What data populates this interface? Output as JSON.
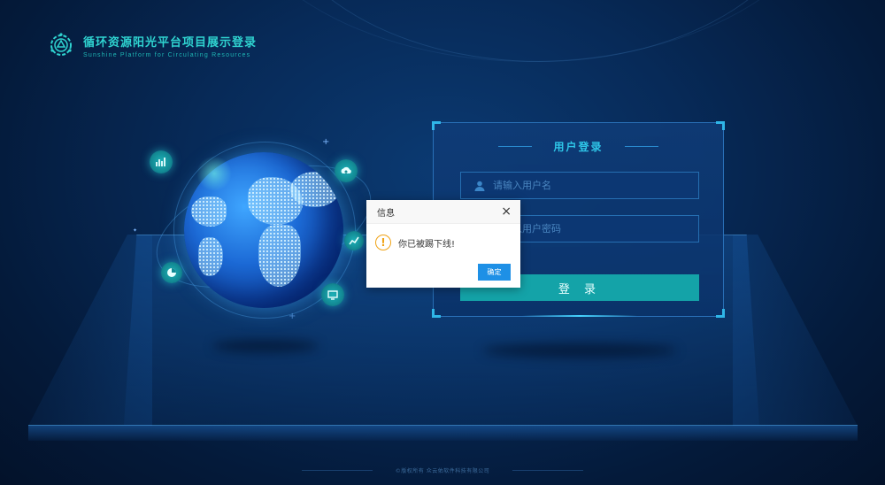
{
  "brand": {
    "title": "循环资源阳光平台项目展示登录",
    "subtitle": "Sunshine Platform for Circulating Resources",
    "logo_icon": "recycle-gear-logo"
  },
  "login": {
    "title": "用户登录",
    "username": {
      "placeholder": "请输入用户名",
      "icon": "user-icon"
    },
    "password": {
      "placeholder": "请输入用户密码",
      "icon": "lock-icon"
    },
    "submit_label": "登 录"
  },
  "dialog": {
    "title": "信息",
    "close_label": "×",
    "icon": "warning-icon",
    "icon_glyph": "!",
    "message": "你已被踢下线!",
    "ok_label": "确定"
  },
  "footer": {
    "copyright": "©版权所有 众云佑软件科技有限公司"
  },
  "decor_icons": [
    "chart-icon",
    "cloud-upload-icon",
    "trend-icon",
    "pie-chart-icon",
    "monitor-icon"
  ],
  "colors": {
    "accent": "#14a3a8",
    "title_teal": "#2fd3d0",
    "dialog_button": "#1e90e6",
    "warning": "#f0a316",
    "background": "#072a58"
  }
}
